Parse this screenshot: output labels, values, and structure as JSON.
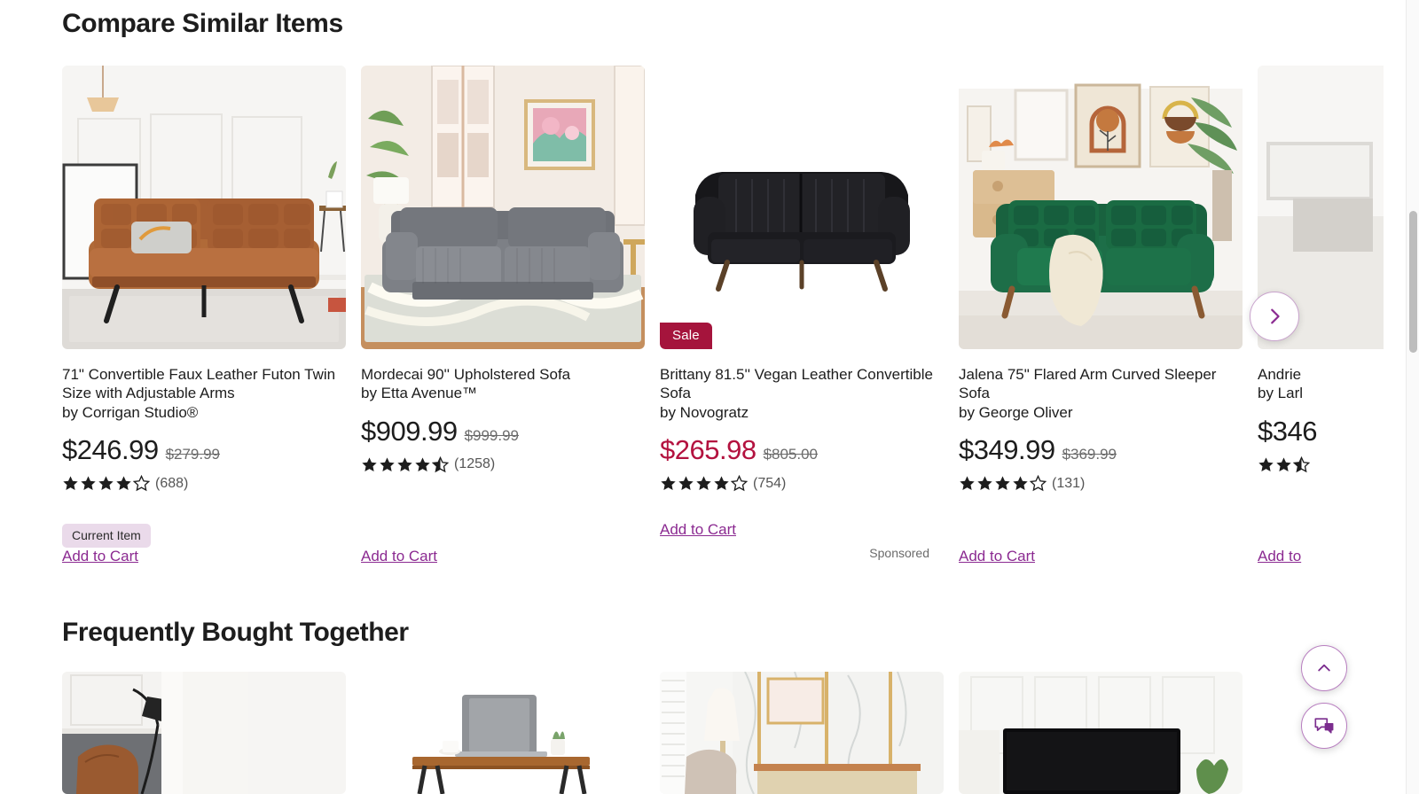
{
  "sections": {
    "compare": {
      "title": "Compare Similar Items"
    },
    "frequently_bought": {
      "title": "Frequently Bought Together"
    }
  },
  "carousel": {
    "next_label": "chevron-right",
    "products": [
      {
        "name": "71\" Convertible Faux Leather Futon Twin Size with Adjustable Arms",
        "brand": "by Corrigan Studio®",
        "price": "$246.99",
        "price_was": "$279.99",
        "on_sale": false,
        "rating": 4,
        "rating_half": false,
        "reviews": "(688)",
        "badge": "Current Item",
        "cta": "Add to Cart",
        "sponsored": null,
        "image": "brown-leather-futon-in-white-paneled-room"
      },
      {
        "name": "Mordecai 90'' Upholstered Sofa",
        "brand": "by Etta Avenue™",
        "price": "$909.99",
        "price_was": "$999.99",
        "on_sale": false,
        "rating": 4,
        "rating_half": true,
        "reviews": "(1258)",
        "badge": null,
        "cta": "Add to Cart",
        "sponsored": null,
        "image": "grey-corduroy-sofa-in-bright-living-room"
      },
      {
        "name": "Brittany 81.5'' Vegan Leather Convertible Sofa",
        "brand": "by Novogratz",
        "price": "$265.98",
        "price_was": "$805.00",
        "on_sale": true,
        "sale_badge": "Sale",
        "rating": 4,
        "rating_half": false,
        "reviews": "(754)",
        "badge": null,
        "cta": "Add to Cart",
        "sponsored": "Sponsored",
        "image": "black-channel-tufted-sofa-on-white"
      },
      {
        "name": "Jalena 75\" Flared Arm Curved Sleeper Sofa",
        "brand": "by George Oliver",
        "price": "$349.99",
        "price_was": "$369.99",
        "on_sale": false,
        "rating": 4,
        "rating_half": false,
        "reviews": "(131)",
        "badge": null,
        "cta": "Add to Cart",
        "sponsored": null,
        "image": "green-velvet-sofa-with-cream-throw"
      },
      {
        "name": "Andrie",
        "brand": "by Larl",
        "price": "$346",
        "price_was": "",
        "on_sale": false,
        "rating": 2,
        "rating_half": true,
        "reviews": "",
        "badge": null,
        "cta": "Add to",
        "sponsored": null,
        "image": "blue-armchair-room-partial"
      }
    ]
  },
  "frequently_bought": {
    "items": [
      {
        "image": "brown-leather-chair-with-floor-lamp"
      },
      {
        "image": "wooden-desk-with-laptop"
      },
      {
        "image": "beige-armchair-with-marble-wall"
      },
      {
        "image": "flat-screen-tv-on-white-panel-wall"
      }
    ]
  },
  "floating_actions": {
    "scroll_top": "scroll-to-top",
    "chat": "chat-support"
  },
  "colors": {
    "sale_badge": "#a5143c",
    "sale_price": "#b3123f",
    "link": "#8b2a91",
    "current_item_badge": "#eadaea",
    "accent_purple": "#8b2a91"
  }
}
